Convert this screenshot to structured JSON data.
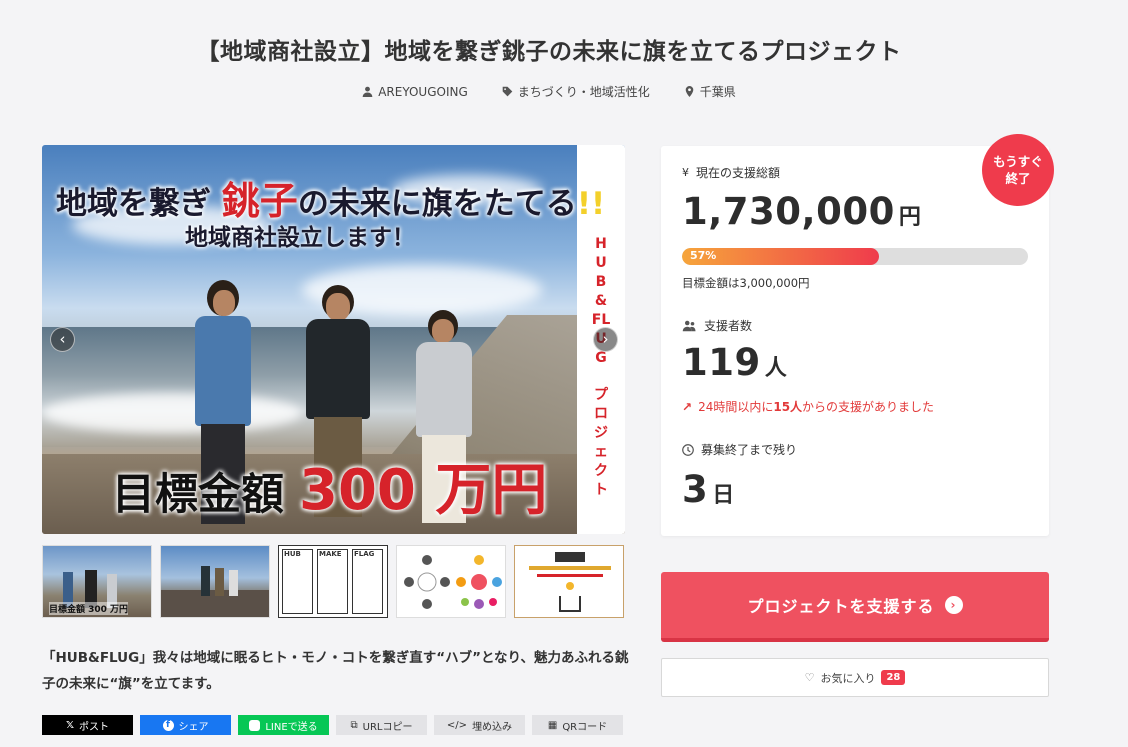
{
  "title": "【地域商社設立】地域を繋ぎ銚子の未来に旗を立てるプロジェクト",
  "meta": {
    "owner": "AREYOUGOING",
    "category": "まちづくり・地域活性化",
    "location": "千葉県"
  },
  "hero": {
    "line1_a": "地域を繋ぎ",
    "line1_b": "銚子",
    "line1_c": "の未来に旗をたてる",
    "line1_d": "!!",
    "line2": "地域商社設立します！",
    "goal_a": "目標金額",
    "goal_b": "300 万円",
    "vertical_1": "HUB&FLUG",
    "vertical_2": "プロジェクト"
  },
  "thumbs": {
    "t1_caption": "目標金額 300 万円",
    "t3_labels": [
      "HUB",
      "MAKE",
      "FLAG"
    ]
  },
  "description": "「HUB&FLUG」我々は地域に眠るヒト・モノ・コトを繋ぎ直す“ハブ”となり、魅力あふれる銚子の未来に“旗”を立てます。",
  "share": {
    "x": "ポスト",
    "facebook": "シェア",
    "line": "LINEで送る",
    "url": "URLコピー",
    "embed": "埋め込み",
    "qr": "QRコード"
  },
  "stats": {
    "badge": "もうすぐ終了",
    "amount_label": "現在の支援総額",
    "amount": "1,730,000",
    "amount_unit": "円",
    "progress": 57,
    "progress_label": "57%",
    "goal": "目標金額は3,000,000円",
    "backers_label": "支援者数",
    "backers": "119",
    "backers_unit": "人",
    "trend_a": "24時間以内に",
    "trend_b": "15人",
    "trend_c": "からの支援がありました",
    "remaining_label": "募集終了まで残り",
    "remaining": "3",
    "remaining_unit": "日"
  },
  "cta": {
    "label": "プロジェクトを支援する"
  },
  "favorite": {
    "label": "お気に入り",
    "count": "28"
  },
  "colors": {
    "accent": "#ef5160",
    "badge": "#ef3b4c",
    "progress_start": "#f6a53b"
  }
}
